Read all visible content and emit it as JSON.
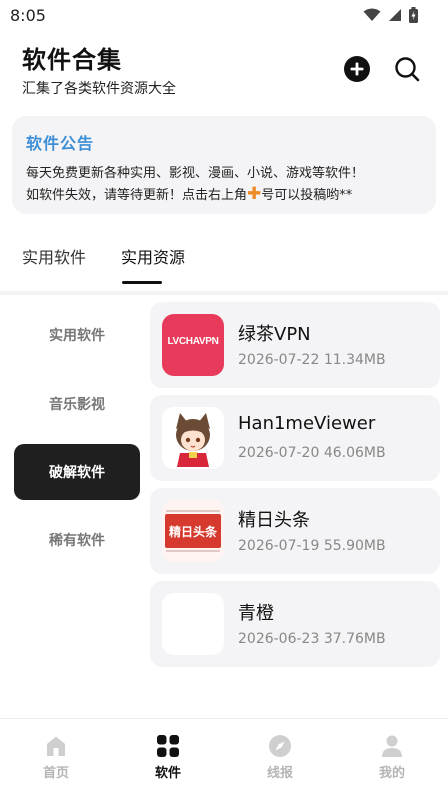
{
  "status_bar": {
    "time": "8:05",
    "icons": [
      "wifi-icon",
      "signal-icon",
      "battery-icon"
    ]
  },
  "header": {
    "title": "软件合集",
    "subtitle": "汇集了各类软件资源大全",
    "actions": [
      "plus-icon",
      "search-icon"
    ]
  },
  "notice": {
    "title": "软件公告",
    "line1": "每天免费更新各种实用、影视、漫画、小说、游戏等软件！",
    "line2_before": "如软件失效，请等待更新！点击右上角",
    "line2_glyph": "✚",
    "line2_after": "号可以投稿哟**"
  },
  "tabs": [
    {
      "label": "实用软件",
      "active": false
    },
    {
      "label": "实用资源",
      "active": true
    }
  ],
  "categories": [
    {
      "label": "实用软件",
      "active": false
    },
    {
      "label": "音乐影视",
      "active": false
    },
    {
      "label": "破解软件",
      "active": true
    },
    {
      "label": "稀有软件",
      "active": false
    }
  ],
  "apps": [
    {
      "name": "绿茶VPN",
      "date": "2026-07-22",
      "size": "11.34MB",
      "icon_text": "LVCHAVPN",
      "icon": "lvcha-vpn-icon"
    },
    {
      "name": "Han1meViewer",
      "date": "2026-07-20",
      "size": "46.06MB",
      "icon": "anime-girl-icon"
    },
    {
      "name": "精日头条",
      "date": "2026-07-19",
      "size": "55.90MB",
      "icon_text": "精日头条",
      "icon": "newspaper-icon"
    },
    {
      "name": "青橙",
      "date": "2026-06-23",
      "size": "37.76MB",
      "icon": "blank-icon"
    }
  ],
  "bottom_nav": [
    {
      "label": "首页",
      "icon": "home-icon",
      "active": false
    },
    {
      "label": "软件",
      "icon": "grid-icon",
      "active": true
    },
    {
      "label": "线报",
      "icon": "compass-icon",
      "active": false
    },
    {
      "label": "我的",
      "icon": "user-icon",
      "active": false
    }
  ],
  "colors": {
    "notice_title": "#3d8fd6",
    "plus_glyph": "#f08a24",
    "active_category_bg": "#1f1f1f",
    "card_bg": "#f4f4f6",
    "vpn_icon_bg": "#e83a5a"
  }
}
